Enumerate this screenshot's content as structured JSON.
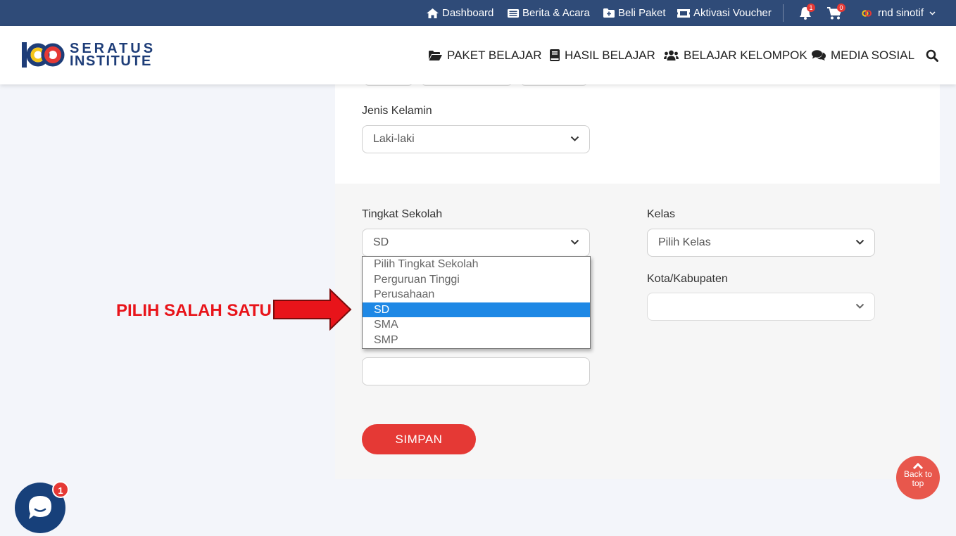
{
  "topbar": {
    "dashboard": "Dashboard",
    "berita": "Berita & Acara",
    "beli_paket": "Beli Paket",
    "aktivasi": "Aktivasi Voucher",
    "notif_count": "1",
    "cart_count": "0",
    "user": "rnd sinotif"
  },
  "header": {
    "logo_line1": "SERATUS",
    "logo_line2": "INSTITUTE",
    "nav": [
      "PAKET BELAJAR",
      "HASIL BELAJAR",
      "BELAJAR KELOMPOK",
      "MEDIA SOSIAL"
    ]
  },
  "form": {
    "jenis_kelamin_label": "Jenis Kelamin",
    "jenis_kelamin_value": "Laki-laki",
    "tingkat_label": "Tingkat Sekolah",
    "tingkat_value": "SD",
    "tingkat_options": [
      "Pilih Tingkat Sekolah",
      "Perguruan Tinggi",
      "Perusahaan",
      "SD",
      "SMA",
      "SMP"
    ],
    "tingkat_selected": "SD",
    "kelas_label": "Kelas",
    "kelas_value": "Pilih Kelas",
    "kota_label": "Kota/Kabupaten",
    "kota_value": "",
    "simpan": "SIMPAN"
  },
  "annotation": {
    "text": "PILIH SALAH SATU",
    "color": "#e8141a"
  },
  "back_to_top": {
    "line1": "Back to",
    "line2": "top"
  },
  "chat": {
    "badge": "1"
  },
  "colors": {
    "topbar": "#2f4b78",
    "brand": "#1e3d78",
    "accent": "#e53935",
    "selected_option": "#1e88e5"
  }
}
